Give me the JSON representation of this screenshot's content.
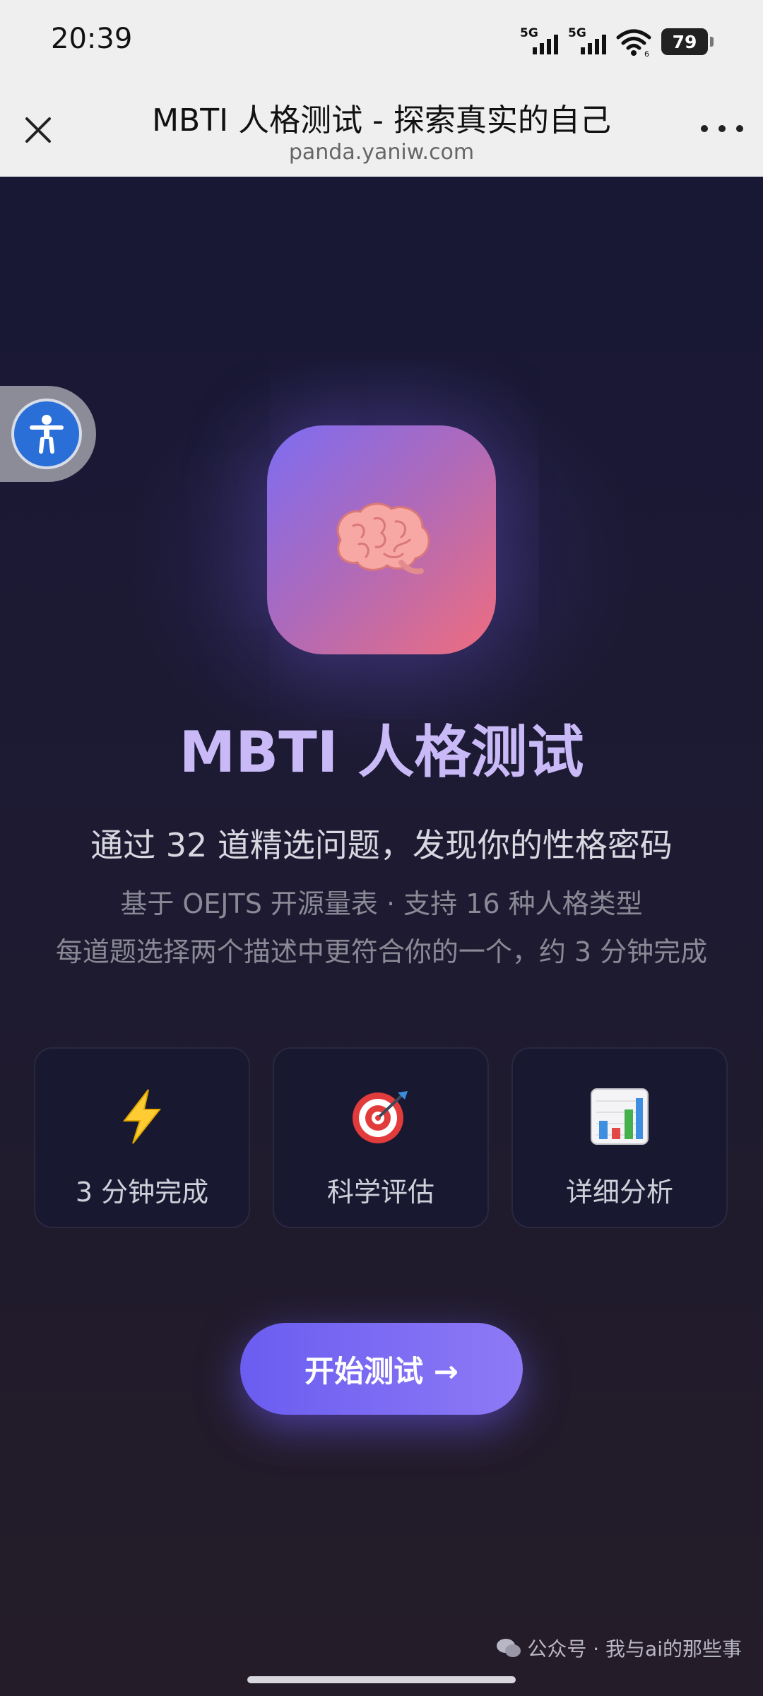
{
  "status_bar": {
    "time": "20:39",
    "signal1_tag": "5G",
    "signal2_tag": "5G",
    "wifi_badge": "6",
    "battery": "79"
  },
  "browser": {
    "title": "MBTI 人格测试 - 探索真实的自己",
    "url": "panda.yaniw.com"
  },
  "hero": {
    "title": "MBTI 人格测试",
    "subtitle": "通过 32 道精选问题，发现你的性格密码",
    "desc_line1": "基于 OEJTS 开源量表 · 支持 16 种人格类型",
    "desc_line2": "每道题选择两个描述中更符合你的一个，约 3 分钟完成"
  },
  "features": [
    {
      "icon": "lightning-icon",
      "label": "3 分钟完成"
    },
    {
      "icon": "target-icon",
      "label": "科学评估"
    },
    {
      "icon": "bar-chart-icon",
      "label": "详细分析"
    }
  ],
  "cta": {
    "label": "开始测试 →"
  },
  "watermark": {
    "text": "公众号 · 我与ai的那些事"
  },
  "colors": {
    "accent": "#7b6cf2",
    "title": "#c9baf7",
    "background": "#1a1930"
  }
}
